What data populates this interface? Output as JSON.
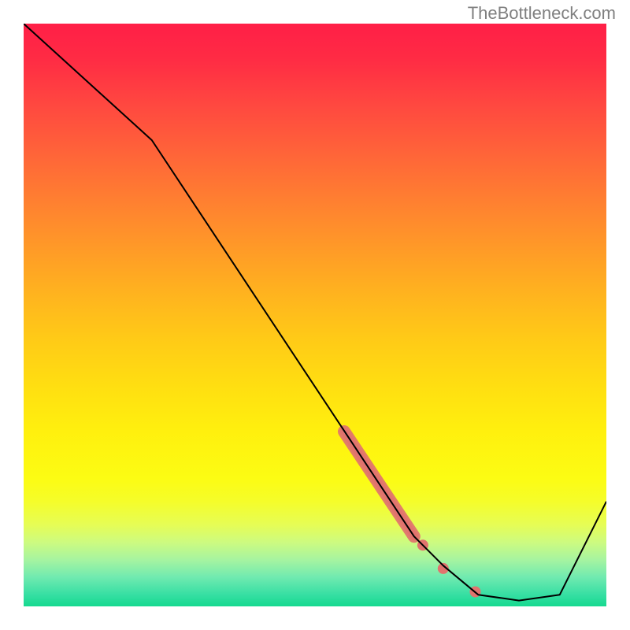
{
  "watermark": "TheBottleneck.com",
  "chart_data": {
    "type": "line",
    "title": "",
    "xlabel": "",
    "ylabel": "",
    "xlim": [
      0,
      100
    ],
    "ylim": [
      0,
      100
    ],
    "grid": false,
    "series": [
      {
        "name": "curve",
        "x": [
          0,
          22,
          67,
          72,
          78,
          85,
          92,
          100
        ],
        "values": [
          100,
          80,
          12,
          7,
          2,
          1,
          2,
          18
        ]
      }
    ],
    "markers": [
      {
        "name": "cluster-segment",
        "x_center": 61,
        "y_center": 21,
        "shape": "thick-segment",
        "color": "#e1736e"
      },
      {
        "name": "dot-a",
        "x": 68.5,
        "y": 10.5,
        "shape": "dot",
        "color": "#e1736e"
      },
      {
        "name": "dot-b",
        "x": 72,
        "y": 6.5,
        "shape": "dot",
        "color": "#e1736e"
      },
      {
        "name": "dot-c",
        "x": 77.5,
        "y": 2.5,
        "shape": "dot",
        "color": "#e1736e"
      }
    ],
    "background_gradient": {
      "stops": [
        {
          "pos": 0.0,
          "color": "#ff1f47"
        },
        {
          "pos": 0.06,
          "color": "#ff2b44"
        },
        {
          "pos": 0.14,
          "color": "#ff4840"
        },
        {
          "pos": 0.22,
          "color": "#ff6339"
        },
        {
          "pos": 0.3,
          "color": "#ff7e31"
        },
        {
          "pos": 0.38,
          "color": "#ff9828"
        },
        {
          "pos": 0.46,
          "color": "#ffb21f"
        },
        {
          "pos": 0.54,
          "color": "#ffca17"
        },
        {
          "pos": 0.62,
          "color": "#ffde11"
        },
        {
          "pos": 0.7,
          "color": "#fff00e"
        },
        {
          "pos": 0.78,
          "color": "#fcfc13"
        },
        {
          "pos": 0.82,
          "color": "#f5fd2a"
        },
        {
          "pos": 0.86,
          "color": "#e6fd55"
        },
        {
          "pos": 0.89,
          "color": "#cdfb80"
        },
        {
          "pos": 0.92,
          "color": "#a6f4a0"
        },
        {
          "pos": 0.95,
          "color": "#70eab0"
        },
        {
          "pos": 0.98,
          "color": "#36dfa3"
        },
        {
          "pos": 1.0,
          "color": "#16d98f"
        }
      ]
    },
    "accent_color": "#e1736e",
    "line_color": "#000000"
  }
}
